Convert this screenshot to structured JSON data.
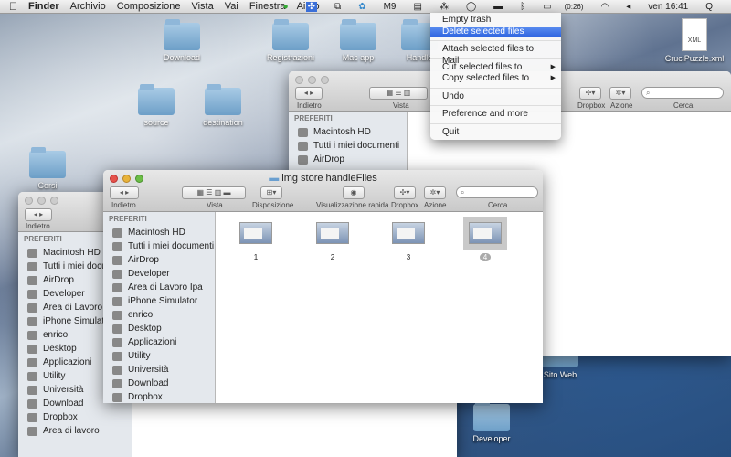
{
  "menubar": {
    "apple": "",
    "app": "Finder",
    "items": [
      "Archivio",
      "Composizione",
      "Vista",
      "Vai",
      "Finestra",
      "Aiuto"
    ],
    "status": {
      "m9": "M9",
      "battery": "(0:26)",
      "clock": "ven 16:41",
      "search": "Q"
    }
  },
  "desktop": {
    "icons": [
      "Download",
      "Registrazioni",
      "Mac app",
      "Handle",
      "source",
      "destination",
      "Corsi",
      "CruciPuzzle.xml",
      "Sito Web",
      "Developer"
    ],
    "xml_badge": "XML"
  },
  "context_menu": {
    "items": [
      "Empty trash",
      "Delete selected files",
      "Attach selected files to Mail",
      "Cut selected files to",
      "Copy selected files to",
      "Undo",
      "Preference and more",
      "Quit"
    ]
  },
  "toolbar": {
    "back": "Indietro",
    "view": "Vista",
    "arrange": "Disposizione",
    "quicklook": "Visualizzazione rapida",
    "dropbox": "Dropbox",
    "action": "Azione",
    "search": "Cerca"
  },
  "front_window": {
    "title": "img store handleFiles",
    "sidebar_header": "PREFERITI",
    "sidebar": [
      "Macintosh HD",
      "Tutti i miei documenti",
      "AirDrop",
      "Developer",
      "Area di Lavoro Ipa",
      "iPhone Simulator",
      "enrico",
      "Desktop",
      "Applicazioni",
      "Utility",
      "Università",
      "Download",
      "Dropbox"
    ],
    "files": [
      "1",
      "2",
      "3",
      "4"
    ]
  },
  "back_window_right": {
    "sidebar_header": "PREFERITI",
    "sidebar": [
      "Macintosh HD",
      "Tutti i miei documenti",
      "AirDrop"
    ]
  },
  "back_window_left": {
    "sidebar_header": "PREFERITI",
    "sidebar": [
      "Macintosh HD",
      "Tutti i miei docu",
      "AirDrop",
      "Developer",
      "Area di Lavoro Ipa",
      "iPhone Simulator",
      "enrico",
      "Desktop",
      "Applicazioni",
      "Utility",
      "Università",
      "Download",
      "Dropbox",
      "Area di lavoro"
    ]
  }
}
